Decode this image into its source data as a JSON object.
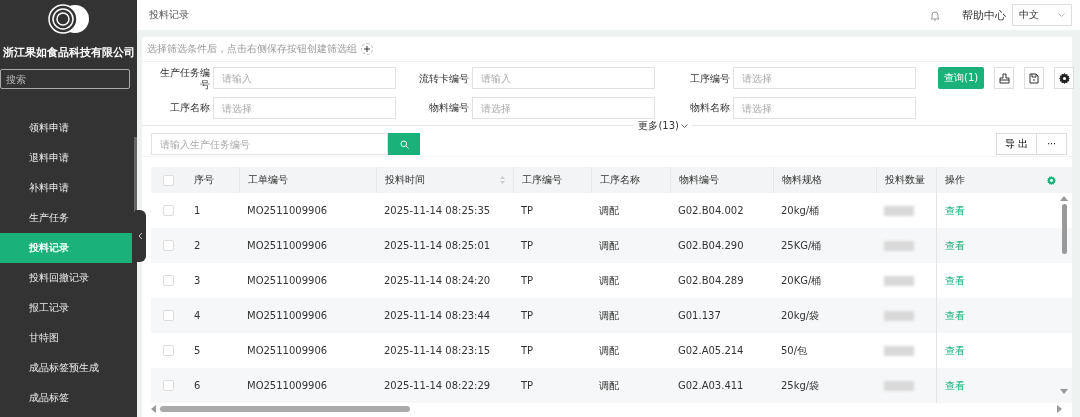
{
  "sidebar": {
    "company": "浙江果如食品科技有限公司",
    "search_placeholder": "搜索",
    "items": [
      {
        "label": "领料申请",
        "selected": false
      },
      {
        "label": "退料申请",
        "selected": false
      },
      {
        "label": "补料申请",
        "selected": false
      },
      {
        "label": "生产任务",
        "selected": false
      },
      {
        "label": "投料记录",
        "selected": true
      },
      {
        "label": "投料回撤记录",
        "selected": false
      },
      {
        "label": "报工记录",
        "selected": false
      },
      {
        "label": "甘特图",
        "selected": false
      },
      {
        "label": "成品标签预生成",
        "selected": false
      },
      {
        "label": "成品标签",
        "selected": false
      }
    ]
  },
  "top_bar": {
    "breadcrumb": "投料记录",
    "help": "帮助中心",
    "language": "中文"
  },
  "filter": {
    "hint": "选择筛选条件后，点击右侧保存按钮创建筛选组",
    "fields": [
      {
        "label": "生产任务编号",
        "placeholder": "请输入"
      },
      {
        "label": "流转卡编号",
        "placeholder": "请输入"
      },
      {
        "label": "工序编号",
        "placeholder": "请选择"
      },
      {
        "label": "工序名称",
        "placeholder": "请选择"
      },
      {
        "label": "物料编号",
        "placeholder": "请选择"
      },
      {
        "label": "物料名称",
        "placeholder": "请选择"
      }
    ],
    "query_button": "查询(1)",
    "more": "更多(13)"
  },
  "toolbar": {
    "search_placeholder": "请输入生产任务编号",
    "export": "导 出",
    "more": "···"
  },
  "table": {
    "all_checked": false,
    "columns": [
      "序号",
      "工单编号",
      "投料时间",
      "工序编号",
      "工序名称",
      "物料编号",
      "物料规格",
      "投料数量",
      "操作"
    ],
    "rows": [
      {
        "no": "1",
        "order": "MO2511009906",
        "time": "2025-11-14 08:25:35",
        "op_code": "TP",
        "op_name": "调配",
        "material": "G02.B04.002",
        "spec": "20kg/桶",
        "action": "查看",
        "checked": false
      },
      {
        "no": "2",
        "order": "MO2511009906",
        "time": "2025-11-14 08:25:01",
        "op_code": "TP",
        "op_name": "调配",
        "material": "G02.B04.290",
        "spec": "25KG/桶",
        "action": "查看",
        "checked": false
      },
      {
        "no": "3",
        "order": "MO2511009906",
        "time": "2025-11-14 08:24:20",
        "op_code": "TP",
        "op_name": "调配",
        "material": "G02.B04.289",
        "spec": "20KG/桶",
        "action": "查看",
        "checked": false
      },
      {
        "no": "4",
        "order": "MO2511009906",
        "time": "2025-11-14 08:23:44",
        "op_code": "TP",
        "op_name": "调配",
        "material": "G01.137",
        "spec": "20kg/袋",
        "action": "查看",
        "checked": false
      },
      {
        "no": "5",
        "order": "MO2511009906",
        "time": "2025-11-14 08:23:15",
        "op_code": "TP",
        "op_name": "调配",
        "material": "G02.A05.214",
        "spec": "50/包",
        "action": "查看",
        "checked": false
      },
      {
        "no": "6",
        "order": "MO2511009906",
        "time": "2025-11-14 08:22:29",
        "op_code": "TP",
        "op_name": "调配",
        "material": "G02.A03.411",
        "spec": "25kg/袋",
        "action": "查看",
        "checked": false
      }
    ]
  }
}
